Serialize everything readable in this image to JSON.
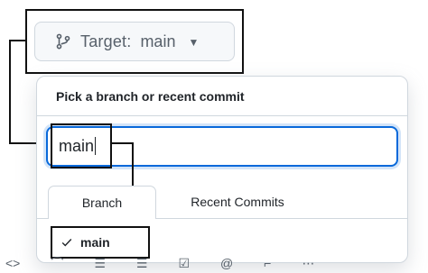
{
  "target_button": {
    "label": "Target:",
    "value": "main",
    "icon": "git-branch-icon",
    "caret_icon": "triangle-down-icon"
  },
  "dropdown": {
    "title": "Pick a branch or recent commit",
    "search": {
      "value": "main",
      "placeholder": ""
    },
    "tabs": [
      {
        "label": "Branch",
        "active": true
      },
      {
        "label": "Recent Commits",
        "active": false
      }
    ],
    "items": [
      {
        "label": "main",
        "selected": true,
        "icon": "check-icon"
      }
    ]
  },
  "toolbar": {
    "icons": [
      "code-icon",
      "link-icon",
      "list-unordered-icon",
      "list-ordered-icon",
      "tasklist-icon",
      "mention-icon",
      "reply-icon",
      "more-icon"
    ]
  }
}
